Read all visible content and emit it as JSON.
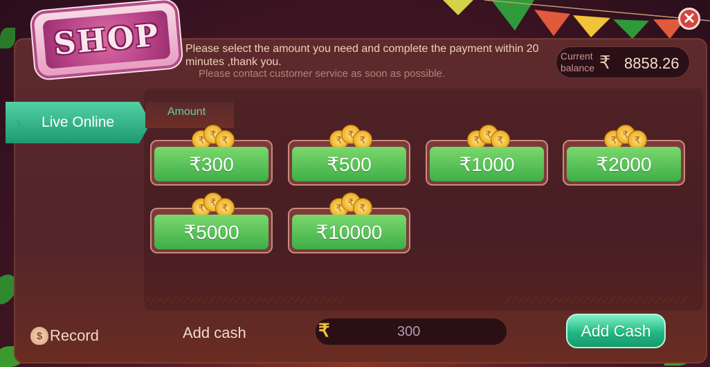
{
  "header": {
    "shop_title": "SHOP",
    "notice_line1": "Please select the amount you need and complete the payment within 20 minutes ,thank you.",
    "notice_line2": "Please contact customer service as soon as possible."
  },
  "balance": {
    "label": "Current balance",
    "currency_symbol": "₹",
    "value": "8858.26"
  },
  "close": {
    "icon": "close-icon",
    "glyph": "✕"
  },
  "sidebar": {
    "tabs": [
      {
        "label": "Live Online",
        "selected": true
      }
    ]
  },
  "amount": {
    "label": "Amount",
    "options": [
      "₹300",
      "₹500",
      "₹1000",
      "₹2000",
      "₹5000",
      "₹10000"
    ]
  },
  "footer": {
    "record_label": "Record",
    "add_cash_label": "Add cash",
    "cash_input_symbol": "₹",
    "cash_input_value": "300",
    "add_cash_button": "Add Cash"
  },
  "colors": {
    "accent_green": "#3fae48",
    "tab_teal": "#1c9a70",
    "close_red": "#d2463e",
    "shop_pink": "#b23e82",
    "rupee_gold": "#f1c23a"
  }
}
